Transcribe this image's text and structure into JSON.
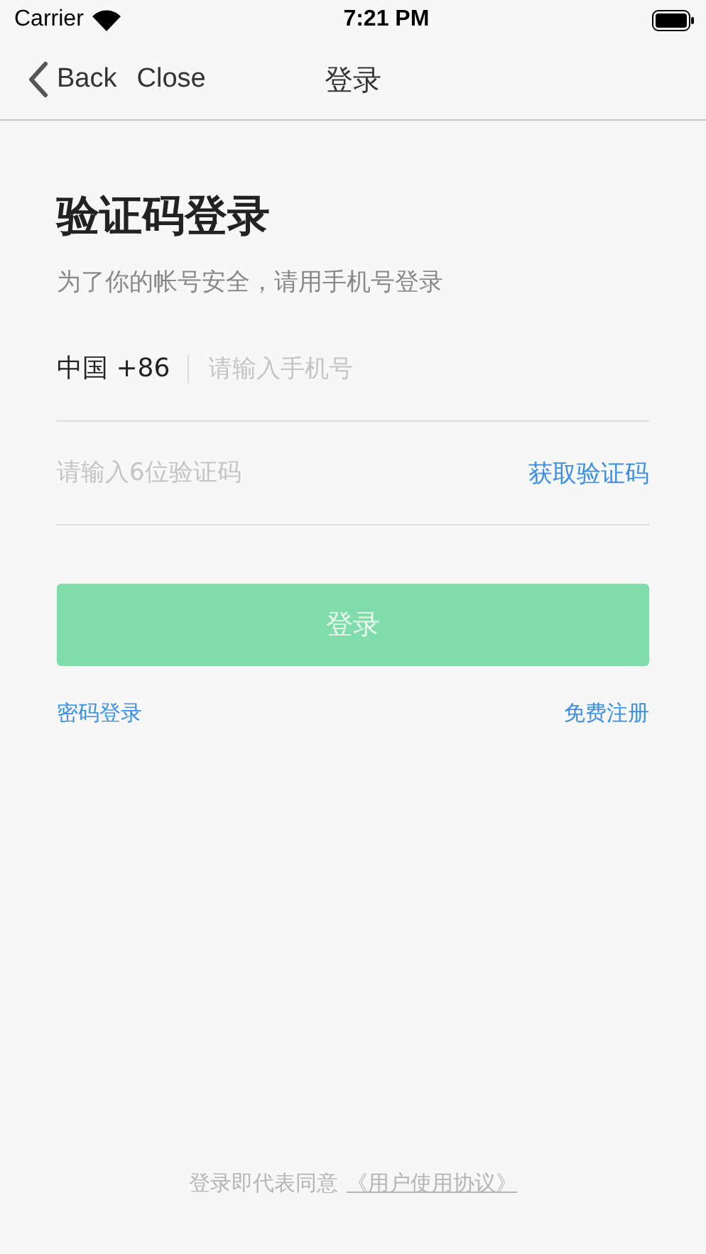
{
  "status_bar": {
    "carrier": "Carrier",
    "time": "7:21 PM"
  },
  "nav_bar": {
    "back": "Back",
    "close": "Close",
    "title": "登录"
  },
  "heading": "验证码登录",
  "subtitle": "为了你的帐号安全，请用手机号登录",
  "phone_field": {
    "country": "中国 +86",
    "placeholder": "请输入手机号"
  },
  "code_field": {
    "placeholder": "请输入6位验证码",
    "action": "获取验证码"
  },
  "login_button": {
    "label": "登录",
    "disabled": true
  },
  "links": [
    "密码登录",
    "免费注册"
  ],
  "footer": {
    "text": "登录即代表同意",
    "link": "《用户使用协议》"
  }
}
